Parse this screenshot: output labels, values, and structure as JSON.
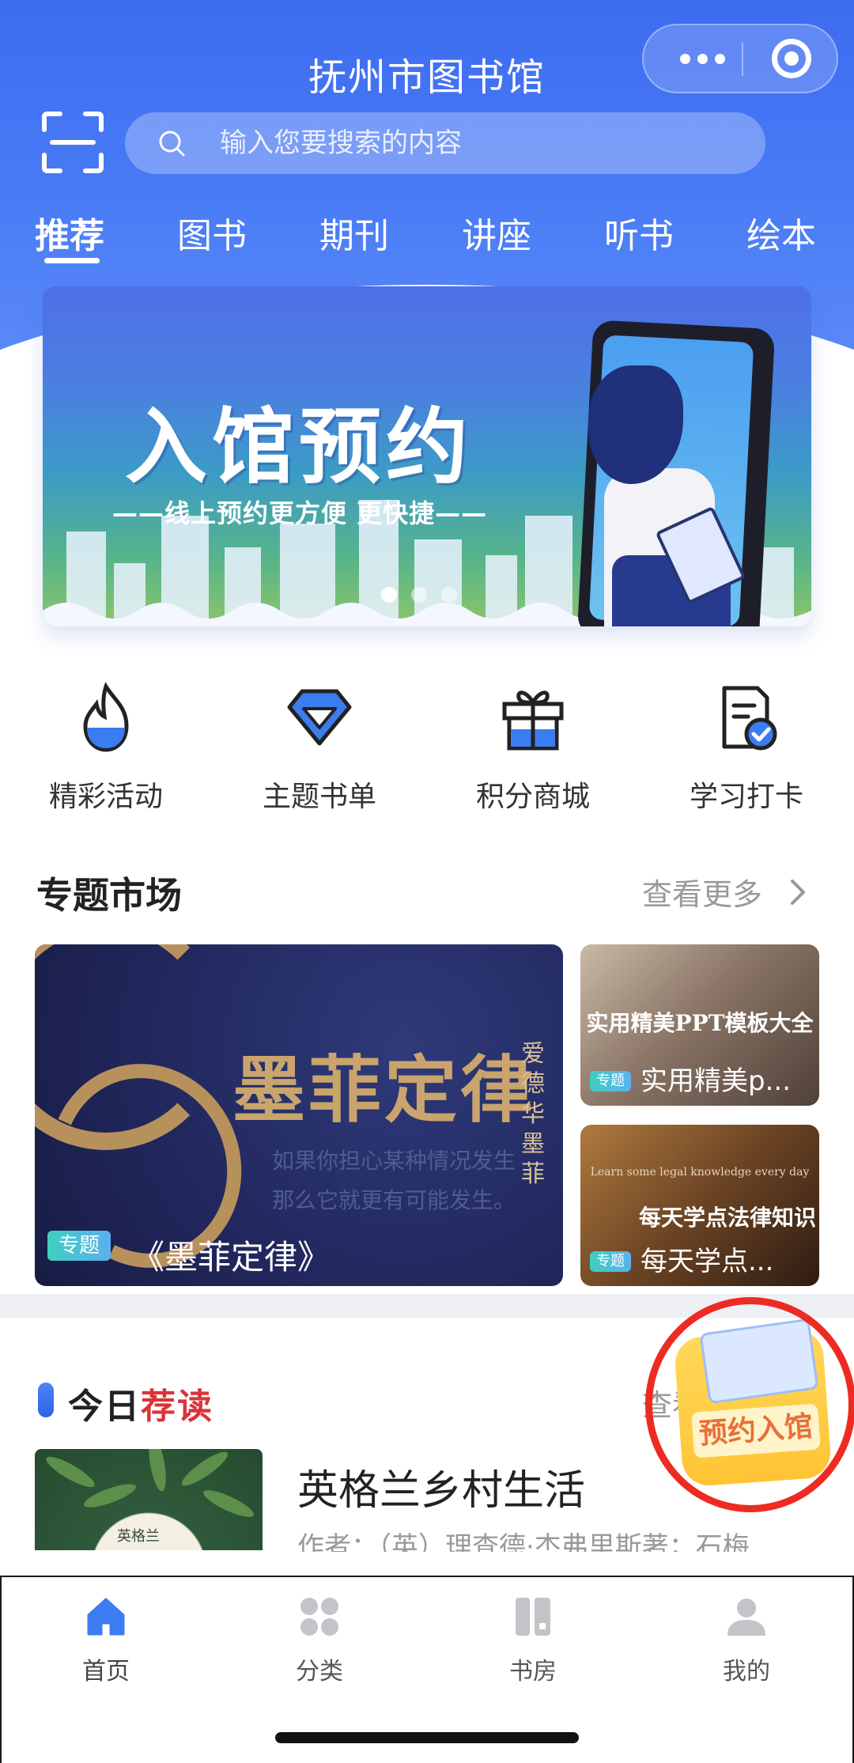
{
  "header": {
    "title": "抚州市图书馆",
    "search_placeholder": "输入您要搜索的内容",
    "tabs": [
      "推荐",
      "图书",
      "期刊",
      "讲座",
      "听书",
      "绘本"
    ],
    "active_tab": "推荐"
  },
  "banner": {
    "title": "入馆预约",
    "subtitle": "——线上预约更方便 更快捷——",
    "slide_count": 3,
    "active_slide": 1
  },
  "quick_entries": [
    {
      "label": "精彩活动",
      "icon": "flame-icon"
    },
    {
      "label": "主题书单",
      "icon": "diamond-icon"
    },
    {
      "label": "积分商城",
      "icon": "gift-icon"
    },
    {
      "label": "学习打卡",
      "icon": "checkin-doc-icon"
    }
  ],
  "topics": {
    "title": "专题市场",
    "more": "查看更多",
    "big": {
      "image_title": "墨菲定律",
      "image_vertical": "爱德华 墨菲",
      "image_line1": "如果你担心某种情况发生",
      "image_line2": "那么它就更有可能发生。",
      "tag": "专题",
      "name": "《墨菲定律》"
    },
    "small": [
      {
        "image_title": "实用精美PPT模板大全",
        "tag": "专题",
        "name": "实用精美p..."
      },
      {
        "image_title": "每天学点法律知识",
        "image_small": "Learn some legal knowledge every day",
        "tag": "专题",
        "name": "每天学点..."
      }
    ]
  },
  "today": {
    "title_prefix": "今日",
    "title_suffix": "荐读",
    "more": "查看",
    "book": {
      "title": "英格兰乡村生活",
      "author": "作者：（英）理查德·杰弗里斯著；石梅",
      "cover_text": "英格兰"
    }
  },
  "float_button": {
    "label": "预约入馆"
  },
  "tabbar": [
    {
      "label": "首页",
      "icon": "home-icon",
      "active": true
    },
    {
      "label": "分类",
      "icon": "category-icon",
      "active": false
    },
    {
      "label": "书房",
      "icon": "bookshelf-icon",
      "active": false
    },
    {
      "label": "我的",
      "icon": "user-icon",
      "active": false
    }
  ],
  "colors": {
    "header_blue": "#4a7cf6",
    "accent_blue": "#3b7cf0",
    "tag_gradient_start": "#3fcfc0",
    "highlight_red": "#ee2b22"
  }
}
